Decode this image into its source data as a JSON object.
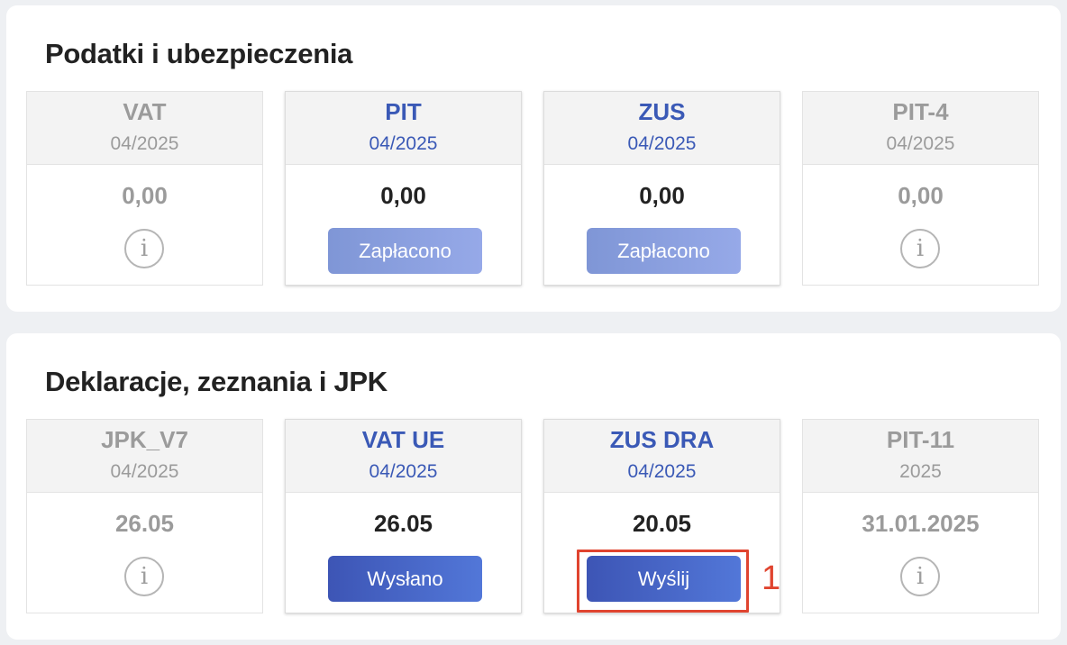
{
  "taxes": {
    "title": "Podatki i ubezpieczenia",
    "tiles": [
      {
        "name": "VAT",
        "period": "04/2025",
        "value": "0,00",
        "state": "inactive"
      },
      {
        "name": "PIT",
        "period": "04/2025",
        "value": "0,00",
        "state": "active",
        "button": "Zapłacono"
      },
      {
        "name": "ZUS",
        "period": "04/2025",
        "value": "0,00",
        "state": "active",
        "button": "Zapłacono"
      },
      {
        "name": "PIT-4",
        "period": "04/2025",
        "value": "0,00",
        "state": "inactive"
      }
    ]
  },
  "declarations": {
    "title": "Deklaracje, zeznania i JPK",
    "tiles": [
      {
        "name": "JPK_V7",
        "period": "04/2025",
        "value": "26.05",
        "state": "inactive"
      },
      {
        "name": "VAT UE",
        "period": "04/2025",
        "value": "26.05",
        "state": "active",
        "button": "Wysłano"
      },
      {
        "name": "ZUS DRA",
        "period": "04/2025",
        "value": "20.05",
        "state": "active",
        "button": "Wyślij"
      },
      {
        "name": "PIT-11",
        "period": "2025",
        "value": "31.01.2025",
        "state": "inactive"
      }
    ]
  },
  "info_icon": {
    "glyph": "i",
    "icon": "info-icon"
  },
  "annotation": {
    "label": "1",
    "color": "#e0442f"
  },
  "colors": {
    "accent": "#3a59b6",
    "paid_button": "#8aa0df",
    "action_button": "#4866c6",
    "muted": "#9b9b9b"
  }
}
